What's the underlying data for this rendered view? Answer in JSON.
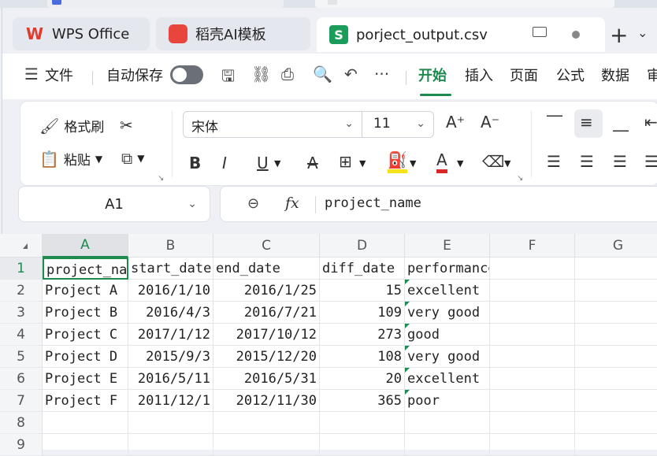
{
  "colors": {
    "accent": "#1d8a4e",
    "wps_red": "#e23b2e",
    "csv_green": "#1c9c5a"
  },
  "tabs": [
    {
      "label": "WPS Office",
      "icon": "wps-logo-icon"
    },
    {
      "label": "稻壳AI模板",
      "icon": "docer-icon"
    },
    {
      "label": "porject_output.csv",
      "icon": "spreadsheet-s-icon",
      "active": true
    }
  ],
  "menu": {
    "hamburger": "☰",
    "file": "文件",
    "autosave": "自动保存",
    "more": "···",
    "tabs": [
      "开始",
      "插入",
      "页面",
      "公式",
      "数据",
      "审"
    ]
  },
  "ribbon": {
    "format_painter": "格式刷",
    "paste": "粘贴",
    "font_name": "宋体",
    "font_size": "11"
  },
  "formula_bar": {
    "cell_ref": "A1",
    "fx": "fx",
    "content": "project_name"
  },
  "grid": {
    "columns": [
      "A",
      "B",
      "C",
      "D",
      "E",
      "F",
      "G"
    ],
    "rows": [
      "1",
      "2",
      "3",
      "4",
      "5",
      "6",
      "7",
      "8",
      "9"
    ],
    "header": [
      "project_name",
      "start_date",
      "end_date",
      "diff_date",
      "performance"
    ],
    "data": [
      [
        "Project A",
        "2016/1/10",
        "2016/1/25",
        "15",
        "excellent"
      ],
      [
        "Project B",
        "2016/4/3",
        "2016/7/21",
        "109",
        "very good"
      ],
      [
        "Project C",
        "2017/1/12",
        "2017/10/12",
        "273",
        "good"
      ],
      [
        "Project D",
        "2015/9/3",
        "2015/12/20",
        "108",
        "very good"
      ],
      [
        "Project E",
        "2016/5/11",
        "2016/5/31",
        "20",
        "excellent"
      ],
      [
        "Project F",
        "2011/12/1",
        "2012/11/30",
        "365",
        "poor"
      ]
    ]
  }
}
